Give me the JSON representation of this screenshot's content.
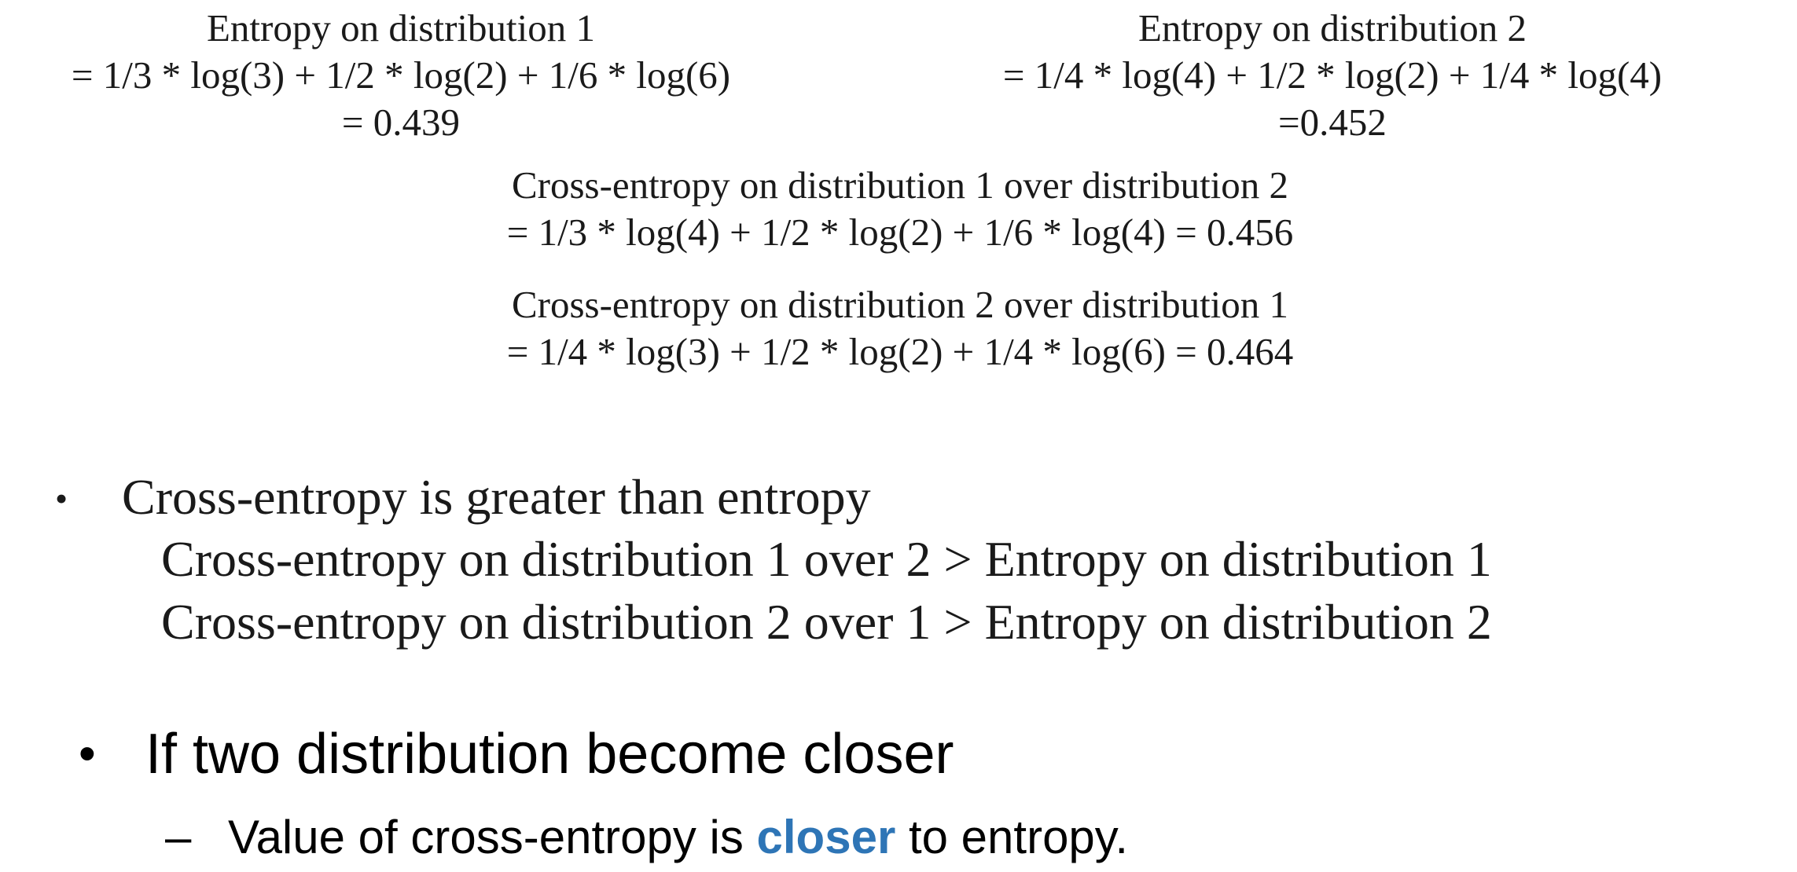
{
  "entropy1": {
    "title": "Entropy on distribution 1",
    "formula": "= 1/3 * log(3) + 1/2 * log(2) + 1/6 * log(6)",
    "result": "= 0.439"
  },
  "entropy2": {
    "title": "Entropy on distribution 2",
    "formula": "= 1/4 * log(4) + 1/2 * log(2) + 1/4 * log(4)",
    "result": "=0.452"
  },
  "cross12": {
    "title": "Cross-entropy on distribution 1 over distribution 2",
    "formula": "= 1/3 * log(4) + 1/2 * log(2) + 1/6 * log(4) =  0.456"
  },
  "cross21": {
    "title": "Cross-entropy on distribution 2 over distribution 1",
    "formula": "= 1/4 * log(3) + 1/2 * log(2) + 1/4 * log(6)  = 0.464"
  },
  "bullet1": {
    "marker": "•",
    "text": "Cross-entropy is greater than entropy",
    "sub1": "Cross-entropy on distribution 1 over 2 > Entropy on distribution 1",
    "sub2": "Cross-entropy on distribution 2 over 1 > Entropy on distribution 2"
  },
  "bullet2": {
    "marker": "•",
    "text": "If two distribution become closer"
  },
  "bullet3": {
    "marker": "–",
    "text_before": "Value of cross-entropy is ",
    "highlight": "closer",
    "text_after": " to entropy."
  },
  "colors": {
    "highlight": "#2e75b6",
    "text": "#000000",
    "serif_text": "#1a1a1a"
  }
}
